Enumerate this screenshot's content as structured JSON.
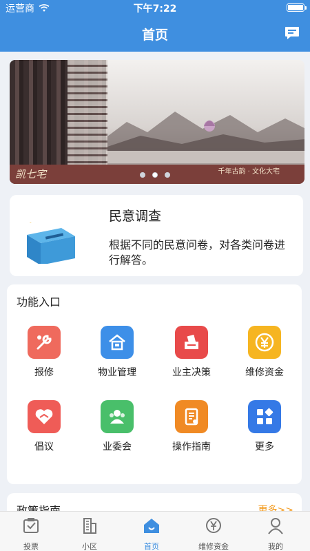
{
  "status_bar": {
    "carrier": "运营商",
    "time": "下午7:22"
  },
  "header": {
    "title": "首页",
    "chat_icon": "chat-bubble-icon"
  },
  "banner": {
    "logo_text": "凯七宅",
    "slogan": "千年古韵 · 文化大宅",
    "pages": 3,
    "active_page": 2
  },
  "survey": {
    "title": "民意调查",
    "description": "根据不同的民意问卷，对各类问卷进行解答。",
    "icon": "ballot-box-icon"
  },
  "functions": {
    "section_title": "功能入口",
    "items": [
      {
        "label": "报修",
        "icon": "wrench-icon",
        "color": "#ef6a5d"
      },
      {
        "label": "物业管理",
        "icon": "property-icon",
        "color": "#3d8fe8"
      },
      {
        "label": "业主决策",
        "icon": "ballot-icon",
        "color": "#e84a4a"
      },
      {
        "label": "维修资金",
        "icon": "yen-coin-icon",
        "color": "#f6b521"
      },
      {
        "label": "倡议",
        "icon": "heart-handshake-icon",
        "color": "#ef5c57"
      },
      {
        "label": "业委会",
        "icon": "group-icon",
        "color": "#49bf6a"
      },
      {
        "label": "操作指南",
        "icon": "guide-icon",
        "color": "#f08a24"
      },
      {
        "label": "更多",
        "icon": "apps-icon",
        "color": "#3579e6"
      }
    ]
  },
  "policy": {
    "title": "政策指南",
    "more": "更多>>"
  },
  "tabbar": {
    "active": "首页",
    "items": [
      {
        "label": "投票",
        "icon": "vote-icon"
      },
      {
        "label": "小区",
        "icon": "building-icon"
      },
      {
        "label": "首页",
        "icon": "home-icon"
      },
      {
        "label": "维修资金",
        "icon": "fund-icon"
      },
      {
        "label": "我的",
        "icon": "user-icon"
      }
    ]
  },
  "colors": {
    "brand": "#3f8fe0",
    "accent_more": "#f39a1c"
  }
}
